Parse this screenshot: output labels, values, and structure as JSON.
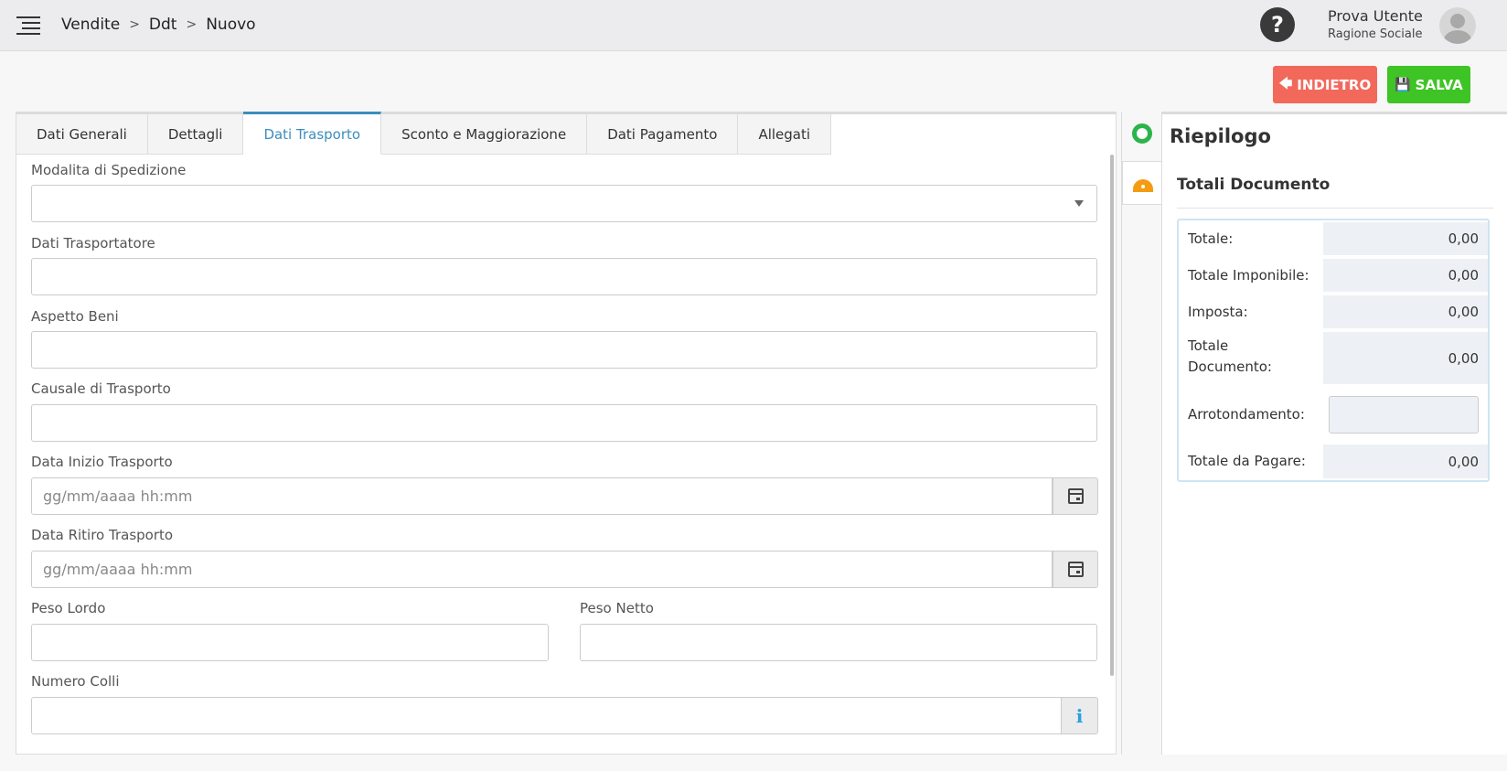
{
  "breadcrumb": [
    "Vendite",
    "Ddt",
    "Nuovo"
  ],
  "help_icon": "question-icon",
  "user": {
    "name": "Prova Utente",
    "company": "Ragione Sociale"
  },
  "actions": {
    "back_label": "INDIETRO",
    "save_label": "SALVA",
    "back_color": "#f2695c",
    "save_color": "#3ec424"
  },
  "tabs": [
    {
      "label": "Dati Generali",
      "active": false
    },
    {
      "label": "Dettagli",
      "active": false
    },
    {
      "label": "Dati Trasporto",
      "active": true
    },
    {
      "label": "Sconto e Maggiorazione",
      "active": false
    },
    {
      "label": "Dati Pagamento",
      "active": false
    },
    {
      "label": "Allegati",
      "active": false
    }
  ],
  "form": {
    "modalita_spedizione": {
      "label": "Modalita di Spedizione",
      "value": ""
    },
    "dati_trasportatore": {
      "label": "Dati Trasportatore",
      "value": ""
    },
    "aspetto_beni": {
      "label": "Aspetto Beni",
      "value": ""
    },
    "causale_trasporto": {
      "label": "Causale di Trasporto",
      "value": ""
    },
    "data_inizio": {
      "label": "Data Inizio Trasporto",
      "placeholder": "gg/mm/aaaa hh:mm"
    },
    "data_ritiro": {
      "label": "Data Ritiro Trasporto",
      "placeholder": "gg/mm/aaaa hh:mm"
    },
    "peso_lordo": {
      "label": "Peso Lordo",
      "value": ""
    },
    "peso_netto": {
      "label": "Peso Netto",
      "value": ""
    },
    "numero_colli": {
      "label": "Numero Colli",
      "value": ""
    }
  },
  "sidebar": {
    "title": "Riepilogo",
    "section_title": "Totali Documento",
    "totals": [
      {
        "label": "Totale:",
        "value": "0,00"
      },
      {
        "label": "Totale Imponibile:",
        "value": "0,00"
      },
      {
        "label": "Imposta:",
        "value": "0,00"
      },
      {
        "label": "Totale Documento:",
        "value": "0,00"
      },
      {
        "label": "Arrotondamento:",
        "value": ""
      },
      {
        "label": "Totale da Pagare:",
        "value": "0,00"
      }
    ]
  },
  "accent_color": "#3c8dbc"
}
